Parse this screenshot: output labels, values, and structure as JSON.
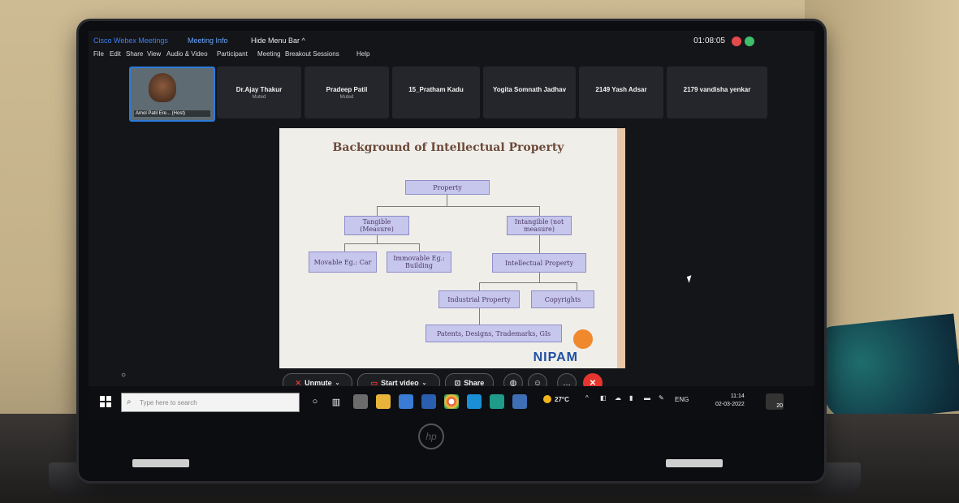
{
  "app": {
    "brand": "Cisco Webex Meetings",
    "meeting_info": "Meeting Info",
    "hide_menu": "Hide Menu Bar",
    "hide_menu_glyph": "^",
    "timer": "01:08:05",
    "window_controls": [
      "–",
      "▫",
      "×"
    ]
  },
  "menu": [
    "File",
    "Edit",
    "Share",
    "View",
    "Audio & Video",
    "Participant",
    "Meeting",
    "Breakout Sessions",
    "Help"
  ],
  "participants": [
    {
      "name": "Amol Patil Ere... (Host)",
      "status": "",
      "self": true
    },
    {
      "name": "Dr.Ajay Thakur",
      "status": "Muted"
    },
    {
      "name": "Pradeep Patil",
      "status": "Muted"
    },
    {
      "name": "15_Pratham Kadu",
      "status": ""
    },
    {
      "name": "Yogita Somnath Jadhav",
      "status": ""
    },
    {
      "name": "2149 Yash Adsar",
      "status": ""
    },
    {
      "name": "2179 vandisha yenkar",
      "status": ""
    }
  ],
  "slide": {
    "title": "Background of Intellectual Property",
    "nodes": {
      "property": "Property",
      "tangible": "Tangible (Measure)",
      "intangible": "Intangible (not measure)",
      "movable": "Movable Eg.: Car",
      "immovable": "Immovable Eg.: Building",
      "ip": "Intellectual Property",
      "industrial": "Industrial Property",
      "copyrights": "Copyrights",
      "patents": "Patents, Designs, Trademarks, GIs"
    },
    "logo": "NIPAM"
  },
  "controls": {
    "unmute": "Unmute",
    "start_video": "Start video",
    "share": "Share",
    "end_glyph": "✕",
    "more_glyph": "…"
  },
  "taskbar": {
    "search_placeholder": "Type here to search",
    "weather": "27°C",
    "language": "ENG",
    "time": "11:14",
    "date": "02-03-2022",
    "notifications": "20"
  },
  "icons": {
    "person": "♟",
    "chat": "○"
  },
  "colors": {
    "accent": "#2b7bd9",
    "end_call": "#e5352e",
    "slide_box": "#c7c6ec"
  }
}
